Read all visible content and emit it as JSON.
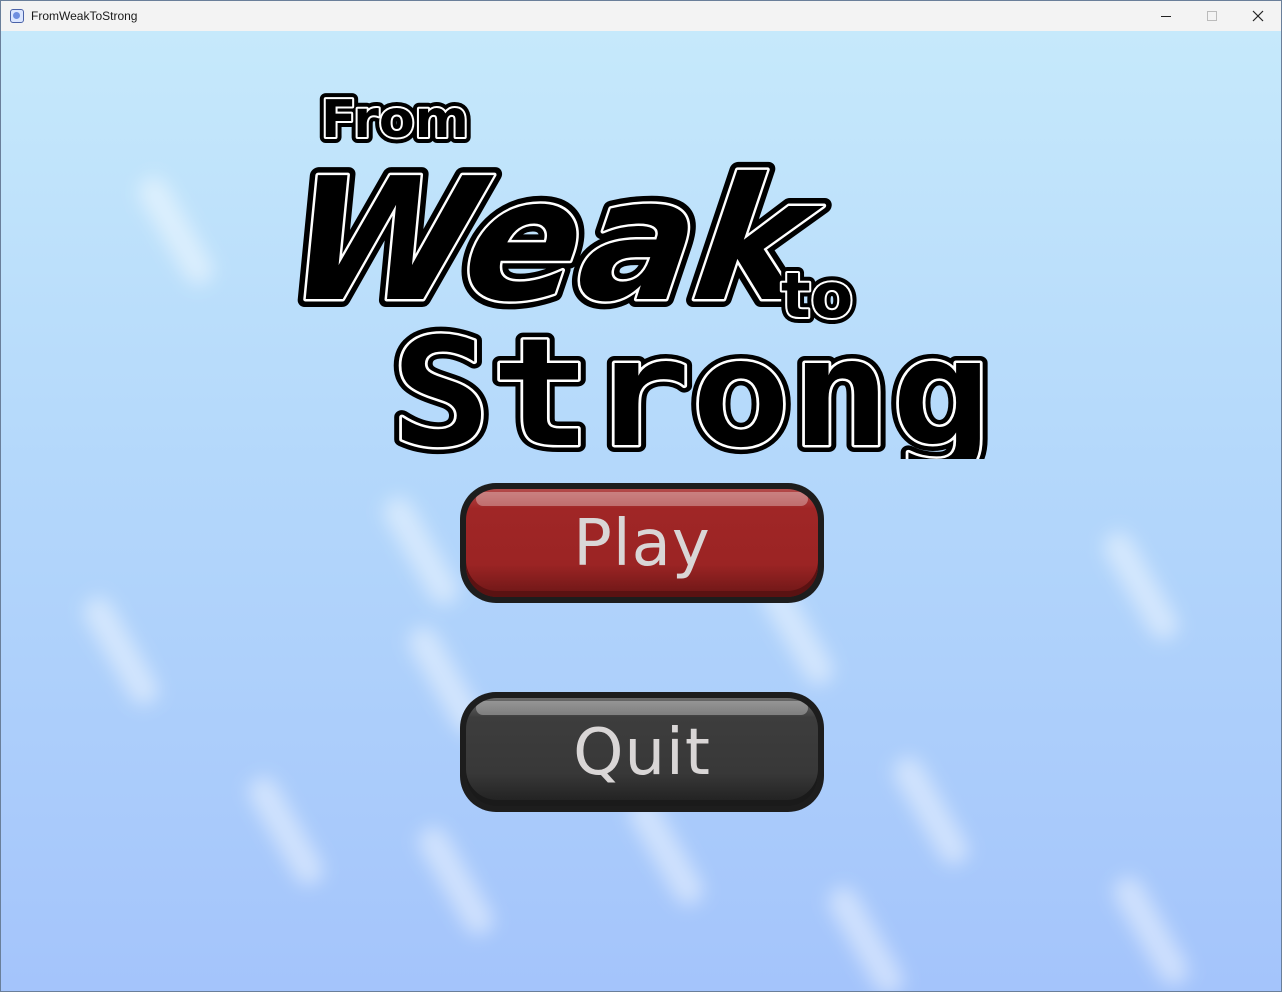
{
  "window": {
    "title": "FromWeakToStrong",
    "icon": "app-window-icon",
    "controls": [
      "minimize-icon",
      "maximize-icon",
      "close-icon"
    ]
  },
  "logo": {
    "line1": "From",
    "line2": "Weak",
    "line3": "to",
    "line4": "Strong"
  },
  "menu": {
    "play_label": "Play",
    "quit_label": "Quit"
  },
  "colors": {
    "sky_top": "#c6e9fb",
    "sky_bottom": "#a4c4fb",
    "play_button": "#9b2424",
    "quit_button": "#383838",
    "button_text": "#d9d6d6",
    "button_border": "#1d1d1d"
  }
}
